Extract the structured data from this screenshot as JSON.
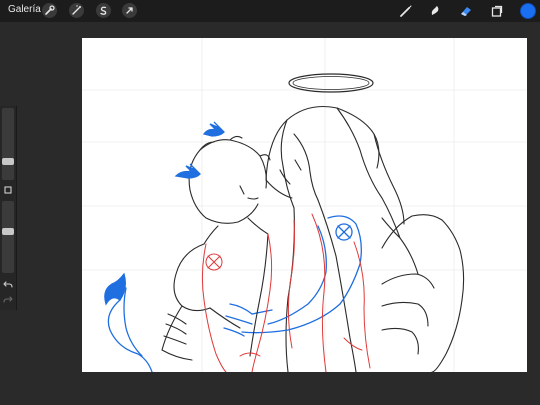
{
  "toolbar": {
    "gallery_label": "Galería",
    "left_tools": [
      {
        "name": "wrench-icon"
      },
      {
        "name": "magic-wand-icon"
      },
      {
        "name": "selection-icon"
      },
      {
        "name": "transform-icon"
      }
    ],
    "right_tools": [
      {
        "name": "brush-icon"
      },
      {
        "name": "smudge-icon"
      },
      {
        "name": "eraser-icon"
      },
      {
        "name": "layers-icon"
      }
    ],
    "current_color": "#1a6ff0"
  },
  "sidebar": {
    "brush_size_level": 0.45,
    "brush_opacity_level": 0.55,
    "modify_label": "",
    "undo_icon": "undo-icon",
    "redo_icon": "redo-icon"
  },
  "colors": {
    "background": "#2a2a2a",
    "topbar": "#1c1c1c",
    "canvas": "#ffffff",
    "sketch_black": "#2b2b2b",
    "sketch_red": "#e03a3a",
    "sketch_blue": "#1f6fe0"
  }
}
